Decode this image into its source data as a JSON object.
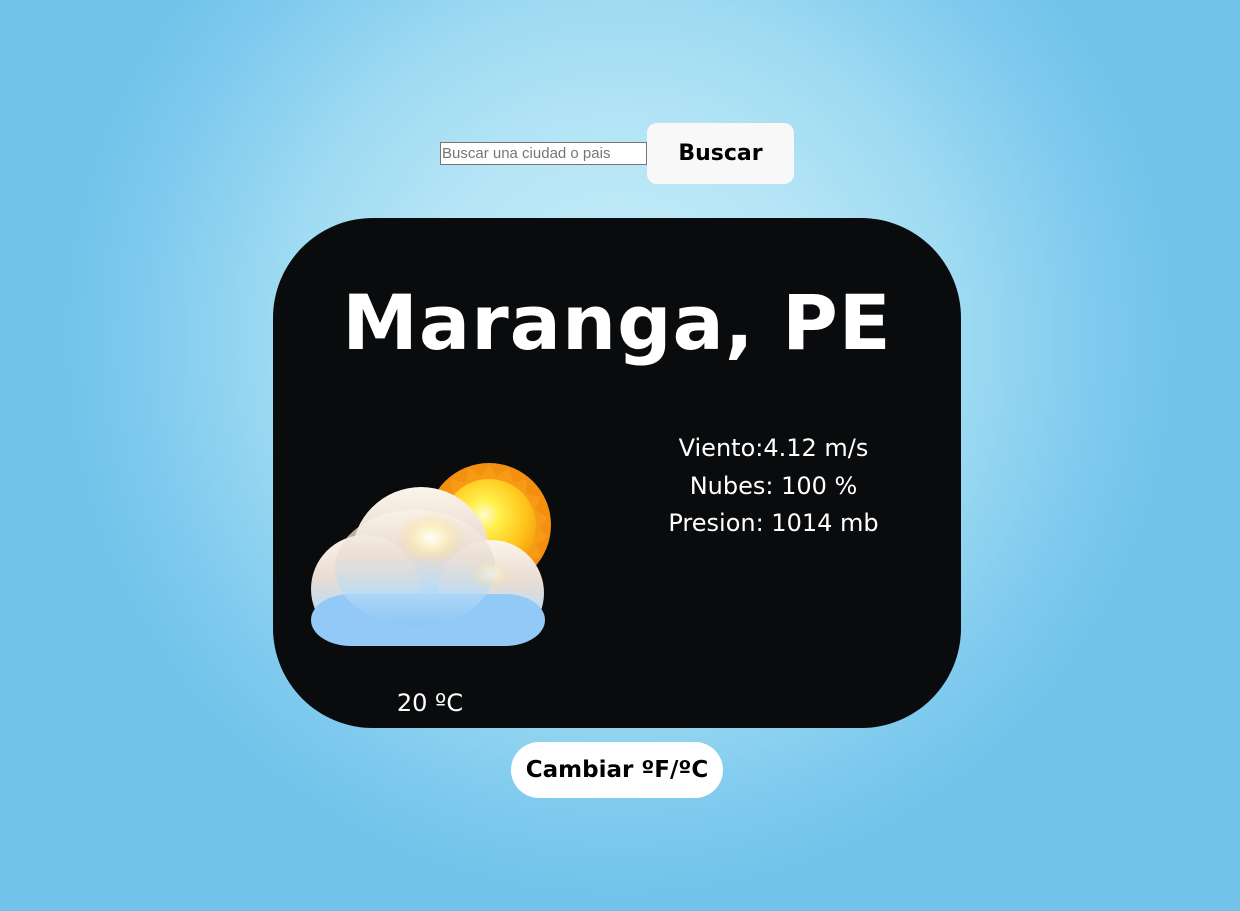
{
  "search": {
    "placeholder": "Buscar una ciudad o pais",
    "value": "",
    "button_label": "Buscar"
  },
  "weather": {
    "city": "Maranga, PE",
    "icon": "partly-cloudy-icon",
    "temperature": "20 ºC",
    "wind": "Viento:4.12 m/s",
    "clouds": "Nubes: 100 %",
    "pressure": "Presion: 1014 mb"
  },
  "toggle": {
    "label": "Cambiar ºF/ºC"
  },
  "colors": {
    "card_background": "#090b0d",
    "page_background": "#9fdbf2",
    "button_background": "#f8f8f8"
  }
}
